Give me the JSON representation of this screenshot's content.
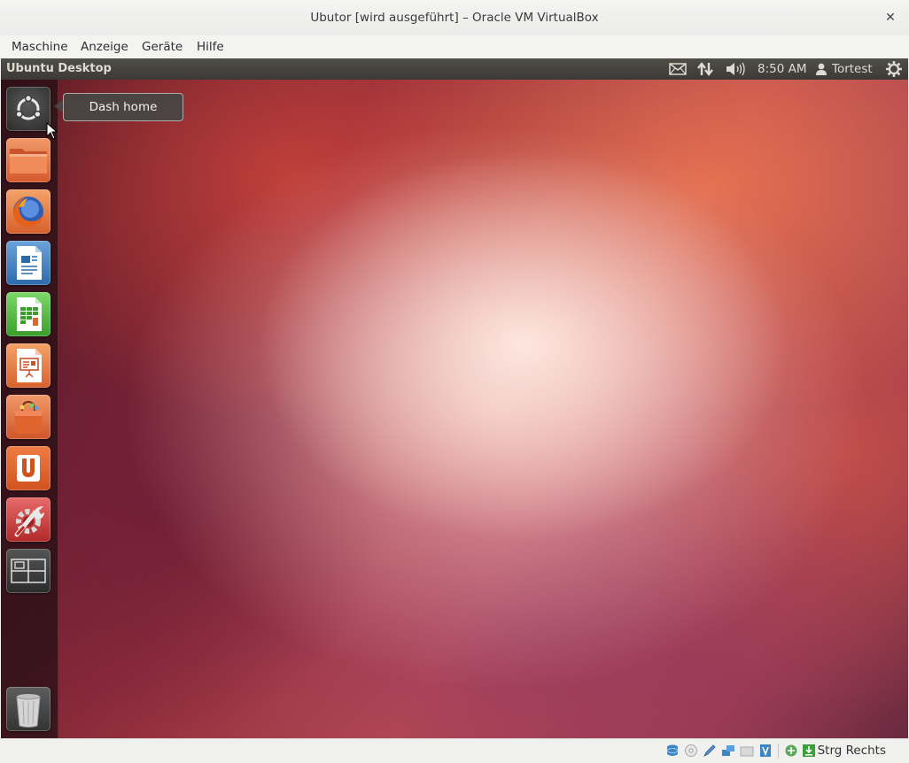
{
  "window": {
    "title": "Ubutor [wird ausgeführt] – Oracle VM VirtualBox",
    "close_glyph": "✕"
  },
  "menu": {
    "items": [
      "Maschine",
      "Anzeige",
      "Geräte",
      "Hilfe"
    ]
  },
  "guest": {
    "panel": {
      "title": "Ubuntu Desktop",
      "time": "8:50 AM",
      "user": "Tortest"
    },
    "tooltip": "Dash home",
    "launcher": [
      {
        "name": "dash-home",
        "icon": "ubuntu-logo-icon"
      },
      {
        "name": "files",
        "icon": "folder-icon"
      },
      {
        "name": "firefox",
        "icon": "firefox-icon"
      },
      {
        "name": "writer",
        "icon": "writer-icon"
      },
      {
        "name": "calc",
        "icon": "calc-icon"
      },
      {
        "name": "impress",
        "icon": "impress-icon"
      },
      {
        "name": "software-center",
        "icon": "shopping-bag-icon"
      },
      {
        "name": "ubuntu-one",
        "icon": "ubuntu-one-icon"
      },
      {
        "name": "system-settings",
        "icon": "settings-wrench-icon"
      },
      {
        "name": "workspace-switcher",
        "icon": "workspaces-icon"
      },
      {
        "name": "trash",
        "icon": "trash-icon"
      }
    ],
    "colors": {
      "panel": "#3f3e3a",
      "launcher_bg": "#2a1016",
      "orange": "#e0642e"
    }
  },
  "statusbar": {
    "host_key": "Strg Rechts"
  }
}
